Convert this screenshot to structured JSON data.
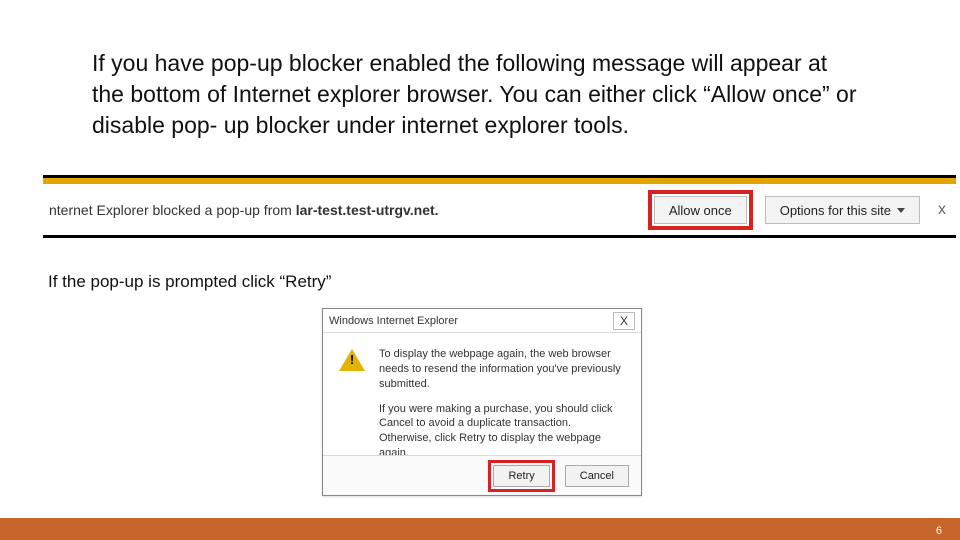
{
  "heading": "If you have pop-up blocker enabled the following message will appear at the bottom of Internet explorer browser. You can either click “Allow once” or disable pop- up blocker under internet explorer tools.",
  "bar": {
    "prefix": "nternet Explorer blocked a pop-up from ",
    "domain": "lar-test.test-utrgv.net.",
    "allow_label": "Allow once",
    "options_label": "Options for this site",
    "close": "x"
  },
  "subhead": "If the pop-up is prompted click “Retry”",
  "dialog": {
    "title": "Windows Internet Explorer",
    "close": "X",
    "p1": "To display the webpage again, the web browser needs to resend the information you've previously submitted.",
    "p2": "If you were making a purchase, you should click Cancel to avoid a duplicate transaction. Otherwise, click Retry to display the webpage again.",
    "retry": "Retry",
    "cancel": "Cancel"
  },
  "page_number": "6"
}
